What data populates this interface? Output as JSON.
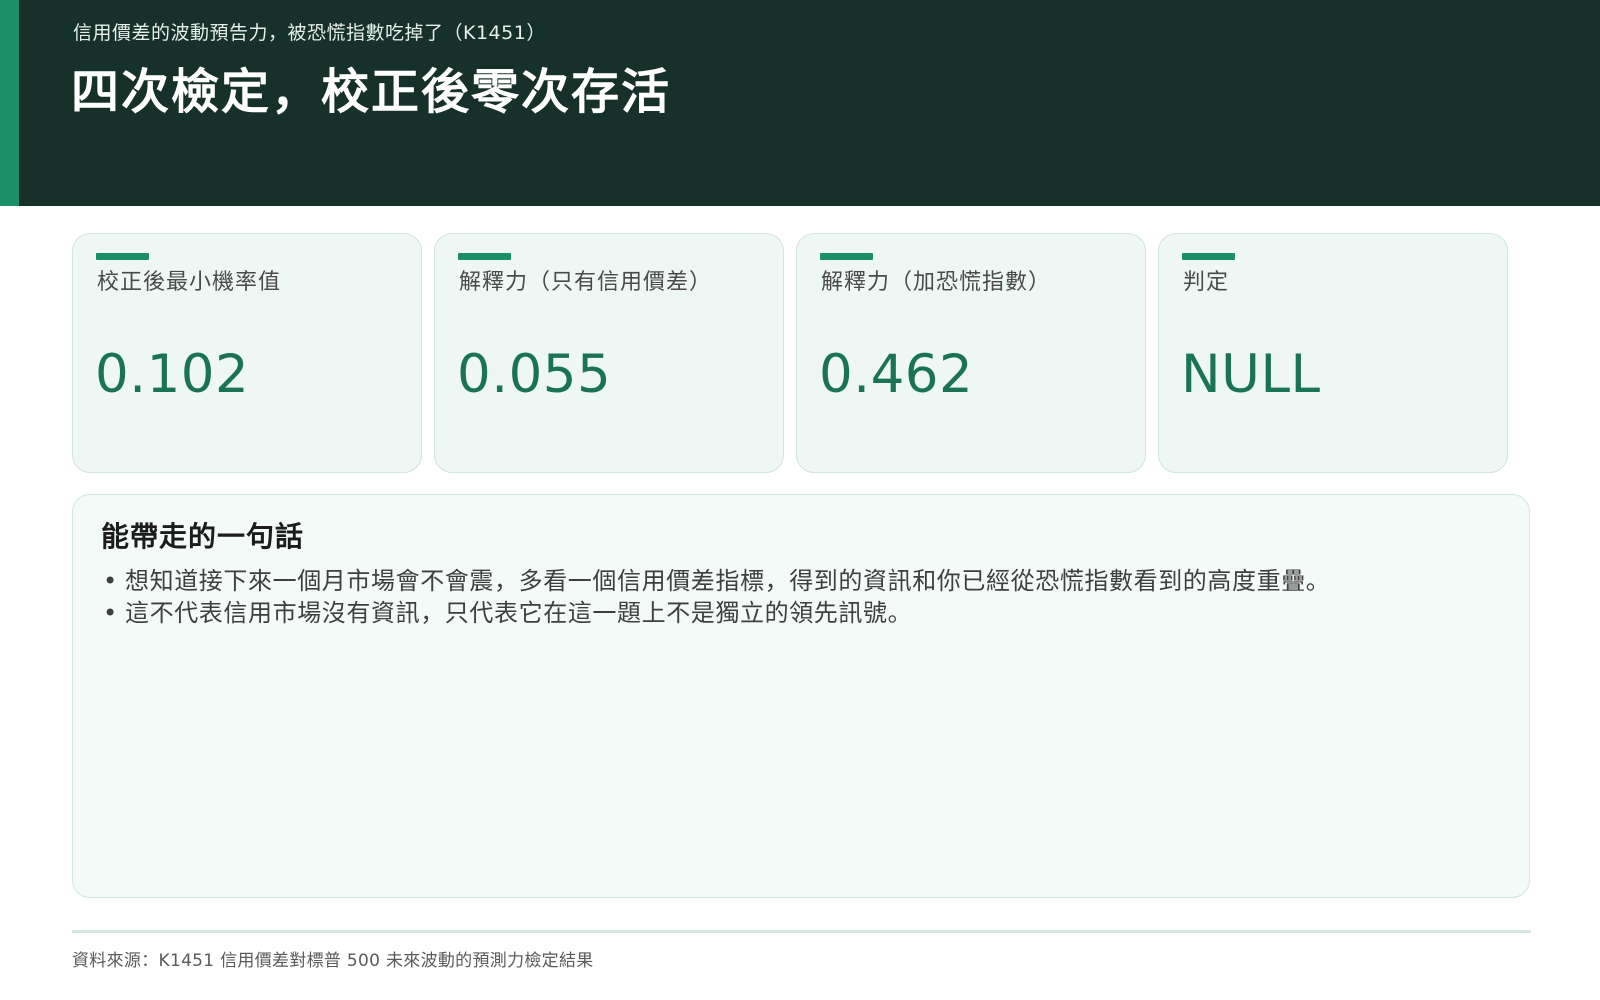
{
  "header": {
    "kicker": "信用價差的波動預告力，被恐慌指數吃掉了（K1451）",
    "title": "四次檢定，校正後零次存活",
    "background_color": "#16302a",
    "accent_color": "#1a8f68"
  },
  "cards": [
    {
      "label": "校正後最小機率值",
      "value": "0.102"
    },
    {
      "label": "解釋力（只有信用價差）",
      "value": "0.055"
    },
    {
      "label": "解釋力（加恐慌指數）",
      "value": "0.462"
    },
    {
      "label": "判定",
      "value": "NULL"
    }
  ],
  "takeaway": {
    "title": "能帶走的一句話",
    "bullet_glyph": "•",
    "bullets": [
      "想知道接下來一個月市場會不會震，多看一個信用價差指標，得到的資訊和你已經從恐慌指數看到的高度重疊。",
      "這不代表信用市場沒有資訊，只代表它在這一題上不是獨立的領先訊號。"
    ]
  },
  "footer": {
    "source": "資料來源：K1451 信用價差對標普 500 未來波動的預測力檢定結果"
  },
  "colors": {
    "value_text": "#1a7356",
    "card_background": "#eef7f3",
    "card_border": "#cfe6dc"
  }
}
